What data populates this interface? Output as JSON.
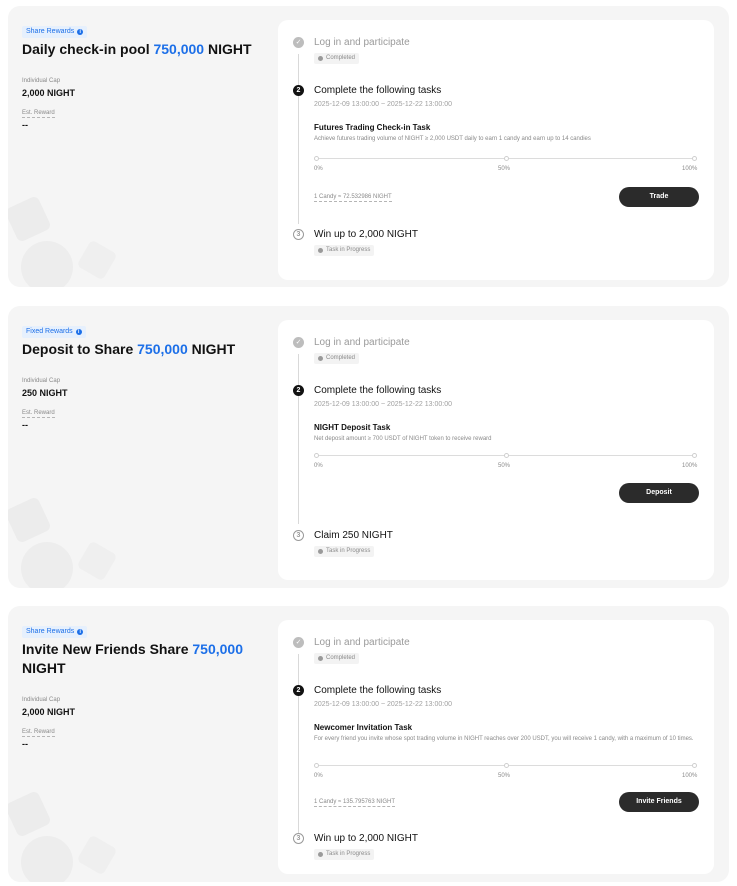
{
  "cards": [
    {
      "tag": "Share Rewards",
      "title_prefix": "Daily check-in pool",
      "title_amount": "750,000",
      "title_suffix": "NIGHT",
      "cap_label": "Individual Cap",
      "cap_value": "2,000 NIGHT",
      "reward_label": "Est. Reward",
      "reward_value": "--",
      "step1_title": "Log in and participate",
      "step1_status": "Completed",
      "step2_num": "2",
      "step2_title": "Complete the following tasks",
      "date_range": "2025-12-09 13:00:00 ~ 2025-12-22 13:00:00",
      "task_name": "Futures Trading Check-in Task",
      "task_desc": "Achieve futures trading volume of NIGHT ≥ 2,000 USDT daily to earn 1 candy and earn up to 14 candies",
      "progress": 0,
      "pct": [
        "0%",
        "50%",
        "100%"
      ],
      "rate": "1 Candy ≈ 72.532986 NIGHT",
      "button": "Trade",
      "step3_num": "3",
      "step3_title": "Win up to 2,000 NIGHT",
      "step3_status": "Task in Progress"
    },
    {
      "tag": "Fixed Rewards",
      "title_prefix": "Deposit to Share",
      "title_amount": "750,000",
      "title_suffix": "NIGHT",
      "cap_label": "Individual Cap",
      "cap_value": "250 NIGHT",
      "reward_label": "Est. Reward",
      "reward_value": "--",
      "step1_title": "Log in and participate",
      "step1_status": "Completed",
      "step2_num": "2",
      "step2_title": "Complete the following tasks",
      "date_range": "2025-12-09 13:00:00 ~ 2025-12-22 13:00:00",
      "task_name": "NIGHT Deposit Task",
      "task_desc": "Net deposit amount ≥ 700 USDT of NIGHT token to receive reward",
      "progress": 0,
      "pct": [
        "0%",
        "50%",
        "100%"
      ],
      "button": "Deposit",
      "step3_num": "3",
      "step3_title": "Claim 250 NIGHT",
      "step3_status": "Task in Progress"
    },
    {
      "tag": "Share Rewards",
      "title_prefix": "Invite New Friends Share",
      "title_amount": "750,000",
      "title_suffix": "NIGHT",
      "cap_label": "Individual Cap",
      "cap_value": "2,000 NIGHT",
      "reward_label": "Est. Reward",
      "reward_value": "--",
      "step1_title": "Log in and participate",
      "step1_status": "Completed",
      "step2_num": "2",
      "step2_title": "Complete the following tasks",
      "date_range": "2025-12-09 13:00:00 ~ 2025-12-22 13:00:00",
      "task_name": "Newcomer Invitation Task",
      "task_desc": "For every friend you invite whose spot trading volume in NIGHT reaches over 200 USDT, you will receive 1 candy, with a maximum of 10 times.",
      "progress": 0,
      "pct": [
        "0%",
        "50%",
        "100%"
      ],
      "rate": "1 Candy ≈ 135.795763 NIGHT",
      "button": "Invite Friends",
      "step3_num": "3",
      "step3_title": "Win up to 2,000 NIGHT",
      "step3_status": "Task in Progress"
    }
  ],
  "colors": {
    "accent": "#1c6fe8",
    "button": "#2b2b2b",
    "card_bg": "#f5f5f5"
  },
  "icons": {
    "tag": "info-icon",
    "step_done": "check-circle-icon",
    "status": "status-dot-icon"
  }
}
